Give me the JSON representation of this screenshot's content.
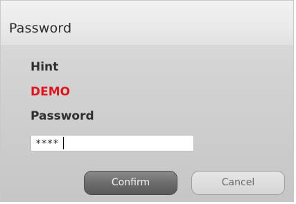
{
  "dialog": {
    "title": "Password",
    "hint_label": "Hint",
    "hint_value": "DEMO",
    "password_label": "Password",
    "password_value": "****",
    "confirm_label": "Confirm",
    "cancel_label": "Cancel"
  },
  "colors": {
    "hint_value": "#e0141e"
  }
}
